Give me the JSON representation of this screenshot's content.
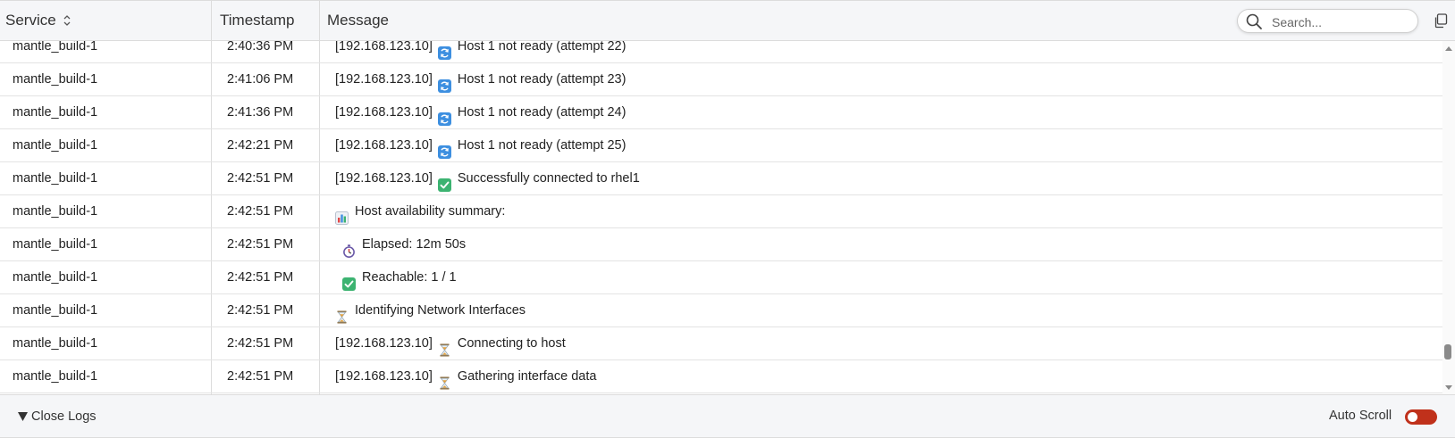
{
  "header": {
    "service_label": "Service",
    "timestamp_label": "Timestamp",
    "message_label": "Message",
    "search_placeholder": "Search..."
  },
  "rows": [
    {
      "service": "mantle_build-1",
      "timestamp": "2:40:36 PM",
      "prefix": "[192.168.123.10]",
      "icon": "refresh-icon",
      "text": "Host 1 not ready (attempt 22)"
    },
    {
      "service": "mantle_build-1",
      "timestamp": "2:41:06 PM",
      "prefix": "[192.168.123.10]",
      "icon": "refresh-icon",
      "text": "Host 1 not ready (attempt 23)"
    },
    {
      "service": "mantle_build-1",
      "timestamp": "2:41:36 PM",
      "prefix": "[192.168.123.10]",
      "icon": "refresh-icon",
      "text": "Host 1 not ready (attempt 24)"
    },
    {
      "service": "mantle_build-1",
      "timestamp": "2:42:21 PM",
      "prefix": "[192.168.123.10]",
      "icon": "refresh-icon",
      "text": "Host 1 not ready (attempt 25)"
    },
    {
      "service": "mantle_build-1",
      "timestamp": "2:42:51 PM",
      "prefix": "[192.168.123.10]",
      "icon": "check-icon",
      "text": "Successfully connected to rhel1"
    },
    {
      "service": "mantle_build-1",
      "timestamp": "2:42:51 PM",
      "prefix": "",
      "icon": "bar-chart-icon",
      "text": "Host availability summary:"
    },
    {
      "service": "mantle_build-1",
      "timestamp": "2:42:51 PM",
      "prefix": "",
      "icon": "stopwatch-icon",
      "text": "Elapsed: 12m 50s",
      "indent": true
    },
    {
      "service": "mantle_build-1",
      "timestamp": "2:42:51 PM",
      "prefix": "",
      "icon": "check-icon",
      "text": "Reachable: 1 / 1",
      "indent": true
    },
    {
      "service": "mantle_build-1",
      "timestamp": "2:42:51 PM",
      "prefix": "",
      "icon": "hourglass-icon",
      "text": "Identifying Network Interfaces"
    },
    {
      "service": "mantle_build-1",
      "timestamp": "2:42:51 PM",
      "prefix": "[192.168.123.10]",
      "icon": "hourglass-icon",
      "text": "Connecting to host"
    },
    {
      "service": "mantle_build-1",
      "timestamp": "2:42:51 PM",
      "prefix": "[192.168.123.10]",
      "icon": "hourglass-icon",
      "text": "Gathering interface data"
    }
  ],
  "footer": {
    "close_logs_label": "Close Logs",
    "auto_scroll_label": "Auto Scroll",
    "auto_scroll_enabled": false
  },
  "colors": {
    "toggle_off": "#c0311b",
    "check_green": "#3cb371",
    "refresh_blue": "#3d8fe0"
  }
}
